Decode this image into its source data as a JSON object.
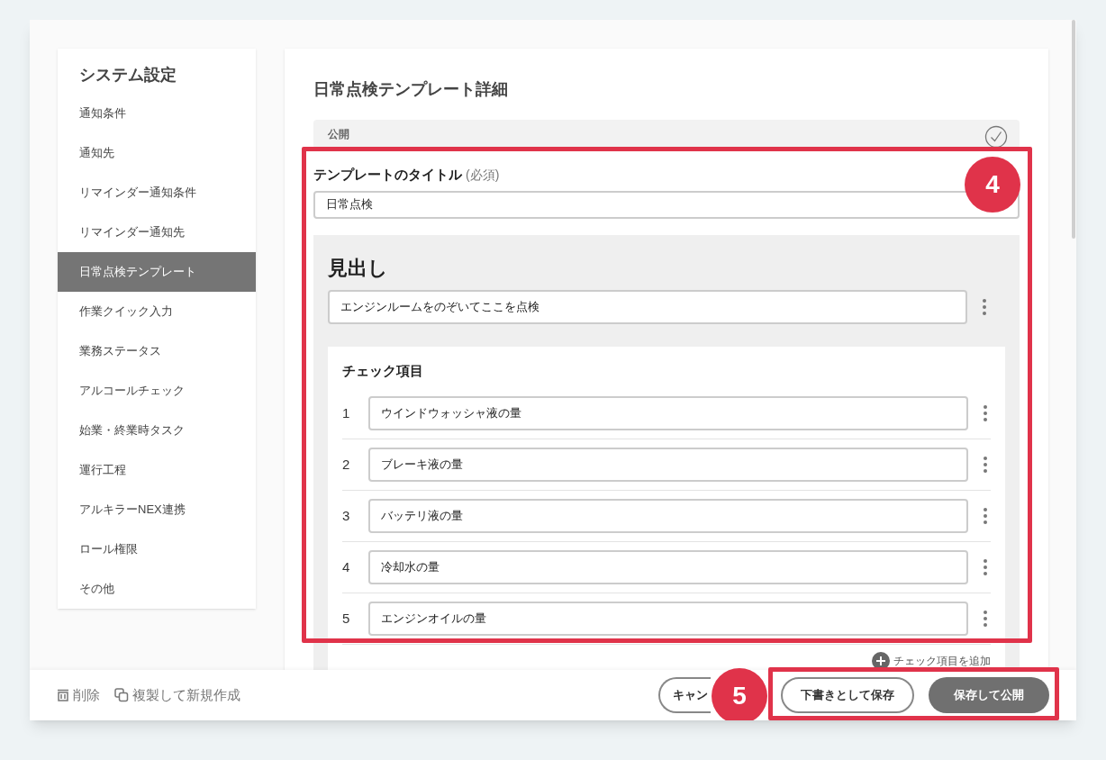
{
  "sidebar": {
    "title": "システム設定",
    "items": [
      {
        "label": "通知条件",
        "selected": false
      },
      {
        "label": "通知先",
        "selected": false
      },
      {
        "label": "リマインダー通知条件",
        "selected": false
      },
      {
        "label": "リマインダー通知先",
        "selected": false
      },
      {
        "label": "日常点検テンプレート",
        "selected": true
      },
      {
        "label": "作業クイック入力",
        "selected": false
      },
      {
        "label": "業務ステータス",
        "selected": false
      },
      {
        "label": "アルコールチェック",
        "selected": false
      },
      {
        "label": "始業・終業時タスク",
        "selected": false
      },
      {
        "label": "運行工程",
        "selected": false
      },
      {
        "label": "アルキラーNEX連携",
        "selected": false
      },
      {
        "label": "ロール権限",
        "selected": false
      },
      {
        "label": "その他",
        "selected": false
      }
    ]
  },
  "detail": {
    "title": "日常点検テンプレート詳細",
    "public_label": "公開",
    "title_field": {
      "label": "テンプレートのタイトル",
      "required": "(必須)",
      "value": "日常点検"
    },
    "heading_section": {
      "label": "見出し",
      "value": "エンジンルームをのぞいてここを点検"
    },
    "checklist": {
      "label": "チェック項目",
      "items": [
        {
          "number": "1",
          "value": "ウインドウォッシャ液の量"
        },
        {
          "number": "2",
          "value": "ブレーキ液の量"
        },
        {
          "number": "3",
          "value": "バッテリ液の量"
        },
        {
          "number": "4",
          "value": "冷却水の量"
        },
        {
          "number": "5",
          "value": "エンジンオイルの量"
        }
      ],
      "add_label": "チェック項目を追加"
    }
  },
  "footer": {
    "left_actions": [
      {
        "kind": "delete",
        "label": "削除"
      },
      {
        "kind": "duplicate",
        "label": "複製して新規作成"
      }
    ],
    "buttons": [
      {
        "kind": "outline",
        "label": "キャン"
      },
      {
        "kind": "outline",
        "label": "下書きとして保存"
      },
      {
        "kind": "filled",
        "label": "保存して公開"
      }
    ]
  },
  "annotations": [
    {
      "label": "4"
    },
    {
      "label": "5"
    }
  ]
}
